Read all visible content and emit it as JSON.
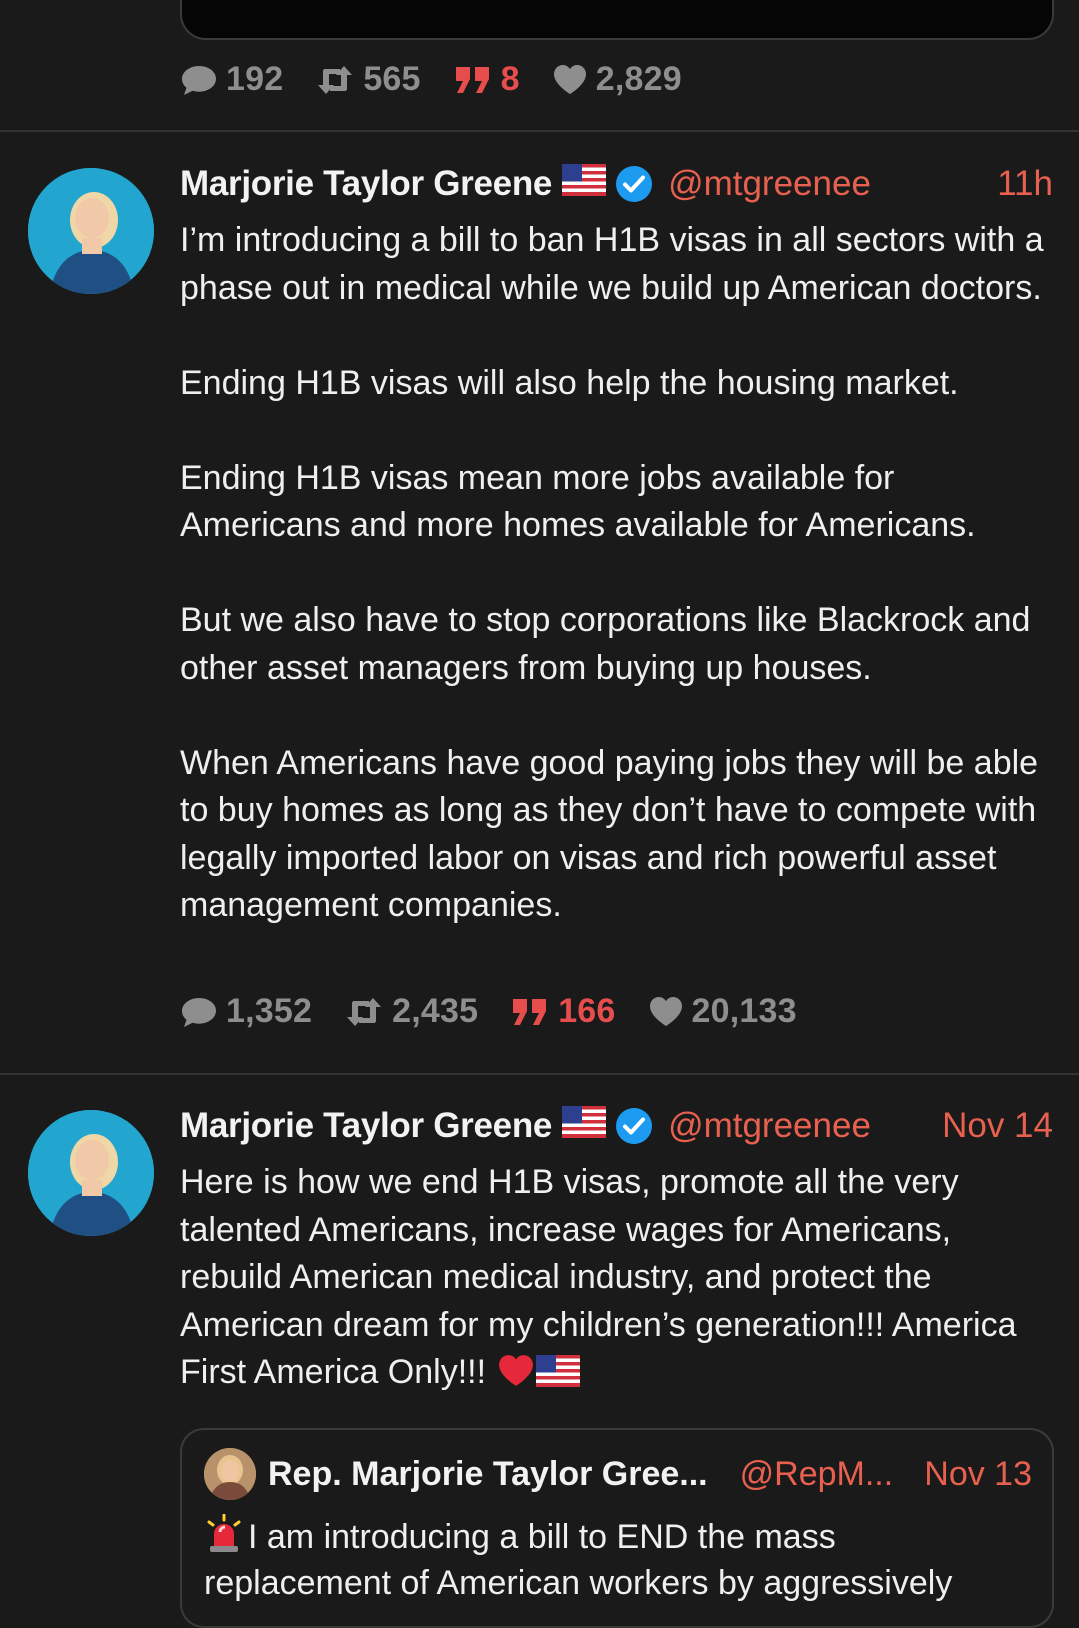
{
  "top_post": {
    "stats": {
      "replies": "192",
      "reposts": "565",
      "quotes": "8",
      "likes": "2,829"
    }
  },
  "posts": [
    {
      "author": "Marjorie Taylor Greene",
      "handle": "@mtgreenee",
      "time": "11h",
      "body": "I’m introducing a bill to ban H1B visas in all sectors with a phase out in medical while we build up American doctors.\n\nEnding H1B visas will also help the housing market.\n\nEnding H1B visas mean more jobs available for Americans and more homes available for Americans.\n\nBut we also have to stop corporations like Blackrock and other asset managers from buying up houses.\n\nWhen Americans have good paying jobs they will be able to buy homes as long as they don’t have to compete with legally imported labor on visas and rich powerful asset management companies.",
      "stats": {
        "replies": "1,352",
        "reposts": "2,435",
        "quotes": "166",
        "likes": "20,133"
      }
    },
    {
      "author": "Marjorie Taylor Greene",
      "handle": "@mtgreenee",
      "time": "Nov 14",
      "body": "Here is how we end H1B visas, promote all the very talented Americans, increase wages for Americans, rebuild American medical industry, and protect the American dream for my children’s generation!!! America First America Only!!!",
      "quoted": {
        "author": "Rep. Marjorie Taylor Gree...",
        "handle": "@RepM...",
        "time": "Nov 13",
        "body": "I am introducing a bill to END the mass",
        "body_line2": "replacement of American workers by aggressively"
      }
    }
  ],
  "colors": {
    "background": "#1a1a1a",
    "accent": "#e8604f",
    "quote_accent": "#e84d4d",
    "muted": "#8e8e8e",
    "verified": "#1d9bf0"
  },
  "icons": {
    "reply": "speech-bubble-icon",
    "repost": "repost-arrows-icon",
    "quote": "quote-marks-icon",
    "like": "heart-icon",
    "verified": "verified-badge-icon",
    "flag": "us-flag-emoji",
    "heart_emoji": "red-heart-emoji",
    "siren": "police-light-emoji"
  }
}
